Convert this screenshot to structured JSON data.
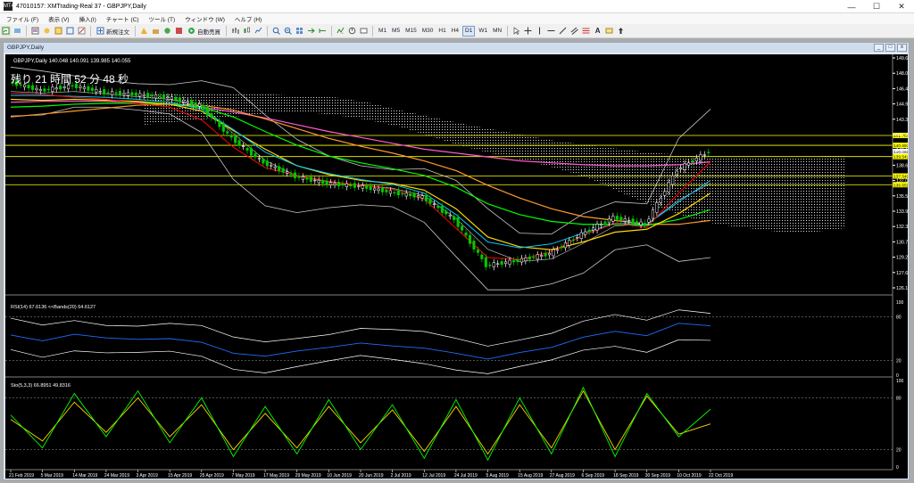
{
  "window": {
    "title": "47010157: XMTrading-Real 37 - GBPJPY,Daily",
    "app_icon": "MT4",
    "minimize": "—",
    "maximize": "☐",
    "close": "✕"
  },
  "menu": [
    "ファイル (F)",
    "表示 (V)",
    "挿入(I)",
    "チャート (C)",
    "ツール (T)",
    "ウィンドウ (W)",
    "ヘルプ (H)"
  ],
  "toolbar": {
    "new_order": "新規注文",
    "auto_trading": "自動売買",
    "timeframes": [
      "M1",
      "M5",
      "M15",
      "M30",
      "H1",
      "H4",
      "D1",
      "W1",
      "MN"
    ]
  },
  "chart_window": {
    "title": "GBPJPY,Daily",
    "ctl_min": "_",
    "ctl_max": "□",
    "ctl_close": "x"
  },
  "chart": {
    "symbol_line": "GBPJPY,Daily  140.048 140.091 139.985 140.055",
    "countdown": "残り 21 時間 52 分 48 秒",
    "rsi_label": "RSI(14) 67.6136  <<Bands(20) 64.6127",
    "stoch_label": "Sto(5,3,3) 66.8951 49.8316",
    "price_ticks": [
      "149.640",
      "148.065",
      "146.490",
      "144.915",
      "143.340",
      "141.765",
      "140.190",
      "138.660",
      "137.085",
      "135.510",
      "133.935",
      "132.360",
      "130.785",
      "129.210",
      "127.635",
      "126.105"
    ],
    "price_markers": [
      {
        "label": "141.704",
        "color": "#ffff00"
      },
      {
        "label": "140.693",
        "color": "#ffff00"
      },
      {
        "label": "140.055",
        "color": "#ffffff"
      },
      {
        "label": "139.541",
        "color": "#ffff00"
      },
      {
        "label": "137.549",
        "color": "#ffff00"
      },
      {
        "label": "136.659",
        "color": "#ffff00"
      }
    ],
    "rsi_ticks": [
      "100",
      "80",
      "20",
      "0"
    ],
    "stoch_ticks": [
      "100",
      "80",
      "20",
      "0"
    ],
    "dates": [
      "21 Feb 2019",
      "5 Mar 2019",
      "14 Mar 2019",
      "24 Mar 2019",
      "3 Apr 2019",
      "15 Apr 2019",
      "25 Apr 2019",
      "7 May 2019",
      "17 May 2019",
      "29 May 2019",
      "10 Jun 2019",
      "20 Jun 2019",
      "2 Jul 2019",
      "12 Jul 2019",
      "24 Jul 2019",
      "5 Aug 2019",
      "15 Aug 2019",
      "27 Aug 2019",
      "6 Sep 2019",
      "18 Sep 2019",
      "30 Sep 2019",
      "10 Oct 2019",
      "22 Oct 2019"
    ]
  },
  "colors": {
    "bg": "#000000",
    "bull_candle": "#ffffff",
    "bear_candle": "#00c800",
    "bands": "#c8c8c8",
    "ma_red": "#ff0000",
    "ma_cyan": "#00c8ff",
    "ma_green": "#00ff00",
    "ma_yellow": "#ffd700",
    "ma_orange": "#ff9a2e",
    "ma_magenta": "#ff5ad2",
    "ichimoku": "#ffffff",
    "rsi_line": "#1e6eff",
    "stoch_main": "#00ff00",
    "stoch_signal": "#ffd700"
  },
  "chart_data": {
    "type": "candlestick",
    "title": "GBPJPY,Daily",
    "ylim": [
      126.1,
      149.64
    ],
    "x": [
      "21 Feb 2019",
      "5 Mar 2019",
      "14 Mar 2019",
      "24 Mar 2019",
      "3 Apr 2019",
      "15 Apr 2019",
      "25 Apr 2019",
      "7 May 2019",
      "17 May 2019",
      "29 May 2019",
      "10 Jun 2019",
      "20 Jun 2019",
      "2 Jul 2019",
      "12 Jul 2019",
      "24 Jul 2019",
      "5 Aug 2019",
      "15 Aug 2019",
      "27 Aug 2019",
      "6 Sep 2019",
      "18 Sep 2019",
      "30 Sep 2019",
      "10 Oct 2019",
      "22 Oct 2019"
    ],
    "close": [
      147.2,
      146.3,
      146.8,
      146.1,
      145.9,
      145.6,
      144.8,
      141.4,
      138.9,
      137.5,
      136.8,
      136.5,
      135.9,
      135.4,
      133.1,
      128.4,
      128.9,
      129.6,
      131.6,
      133.3,
      132.6,
      138.2,
      140.05
    ],
    "ma_red": [
      146.0,
      145.9,
      145.6,
      145.4,
      145.0,
      144.6,
      143.3,
      140.5,
      138.4,
      137.6,
      137.0,
      136.6,
      136.2,
      135.2,
      132.2,
      129.2,
      129.0,
      129.8,
      131.5,
      132.7,
      132.3,
      135.8,
      139.0
    ],
    "ma_yellow": [
      145.4,
      145.3,
      145.4,
      145.3,
      145.2,
      144.9,
      144.2,
      142.2,
      140.3,
      138.6,
      137.7,
      137.1,
      136.8,
      136.1,
      134.2,
      131.3,
      130.3,
      130.0,
      130.8,
      131.8,
      132.1,
      133.7,
      135.8
    ],
    "ma_cyan": [
      145.8,
      145.8,
      145.7,
      145.6,
      145.4,
      145.1,
      144.4,
      142.3,
      140.0,
      138.6,
      137.8,
      137.2,
      136.7,
      135.8,
      133.6,
      130.8,
      130.2,
      130.6,
      131.7,
      132.7,
      132.6,
      134.9,
      137.1
    ],
    "ma_green": [
      144.6,
      144.7,
      144.9,
      145.0,
      145.0,
      144.9,
      144.6,
      143.6,
      142.1,
      140.7,
      139.6,
      138.9,
      138.3,
      137.6,
      136.4,
      134.7,
      133.6,
      132.9,
      132.6,
      132.6,
      132.5,
      133.1,
      134.1
    ],
    "ma_orange": [
      143.6,
      143.9,
      144.2,
      144.5,
      144.8,
      144.9,
      144.8,
      144.3,
      143.4,
      142.4,
      141.4,
      140.6,
      139.9,
      139.1,
      138.1,
      136.6,
      135.3,
      134.2,
      133.4,
      133.0,
      132.6,
      132.6,
      133.0
    ],
    "ma_magenta": [
      145.1,
      145.2,
      145.2,
      145.2,
      145.1,
      144.9,
      144.6,
      144.1,
      143.5,
      142.8,
      142.1,
      141.5,
      140.9,
      140.3,
      139.9,
      139.5,
      139.1,
      138.9,
      138.7,
      138.6,
      138.6,
      138.7,
      139.0
    ],
    "bb_upper": [
      148.7,
      148.3,
      147.8,
      147.3,
      147.0,
      146.9,
      147.3,
      146.6,
      143.8,
      141.3,
      139.6,
      138.6,
      138.2,
      138.3,
      137.1,
      134.2,
      131.7,
      131.6,
      133.7,
      134.9,
      134.7,
      141.4,
      144.4
    ],
    "bb_lower": [
      143.7,
      143.8,
      144.6,
      144.6,
      144.3,
      143.9,
      142.0,
      137.2,
      134.5,
      133.8,
      134.3,
      134.6,
      134.4,
      132.8,
      129.3,
      125.9,
      125.9,
      126.5,
      127.6,
      130.0,
      130.5,
      128.8,
      129.2
    ],
    "rsi": [
      55,
      47,
      56,
      51,
      49,
      50,
      45,
      30,
      26,
      33,
      38,
      44,
      40,
      37,
      30,
      22,
      31,
      38,
      52,
      60,
      54,
      71,
      67.6
    ],
    "stoch_main": [
      60,
      22,
      85,
      35,
      88,
      28,
      80,
      12,
      70,
      15,
      78,
      20,
      72,
      10,
      78,
      8,
      80,
      15,
      92,
      12,
      85,
      35,
      66.9
    ],
    "stoch_signal": [
      55,
      30,
      75,
      40,
      80,
      35,
      72,
      20,
      62,
      22,
      70,
      28,
      66,
      18,
      70,
      15,
      72,
      22,
      88,
      20,
      82,
      38,
      49.8
    ]
  }
}
